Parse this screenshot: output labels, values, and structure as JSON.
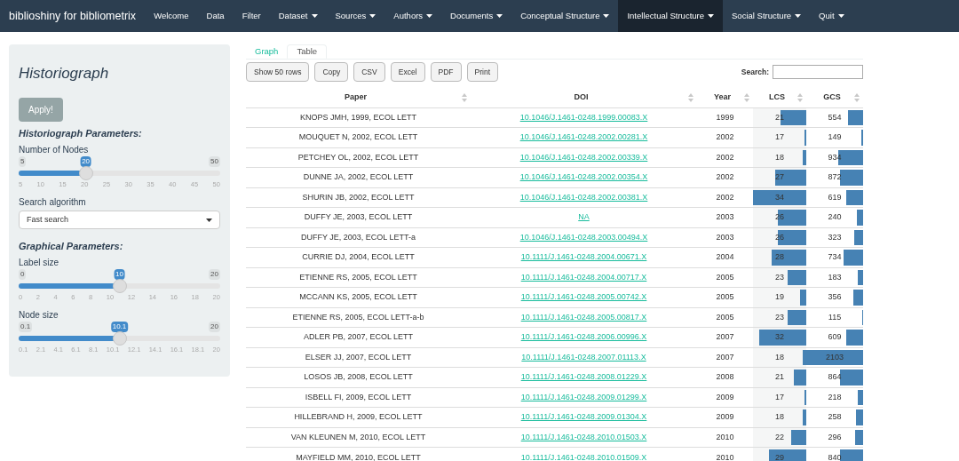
{
  "navbar": {
    "brand": "biblioshiny for bibliometrix",
    "items": [
      {
        "label": "Welcome",
        "dropdown": false,
        "selected": false
      },
      {
        "label": "Data",
        "dropdown": false,
        "selected": false
      },
      {
        "label": "Filter",
        "dropdown": false,
        "selected": false
      },
      {
        "label": "Dataset",
        "dropdown": true,
        "selected": false
      },
      {
        "label": "Sources",
        "dropdown": true,
        "selected": false
      },
      {
        "label": "Authors",
        "dropdown": true,
        "selected": false
      },
      {
        "label": "Documents",
        "dropdown": true,
        "selected": false
      },
      {
        "label": "Conceptual Structure",
        "dropdown": true,
        "selected": false
      },
      {
        "label": "Intellectual Structure",
        "dropdown": true,
        "selected": true
      },
      {
        "label": "Social Structure",
        "dropdown": true,
        "selected": false
      },
      {
        "label": "Quit",
        "dropdown": true,
        "selected": false
      }
    ]
  },
  "sidebar": {
    "title": "Historiograph",
    "apply_button": "Apply!",
    "sections": [
      {
        "heading": "Historiograph Parameters:",
        "controls": [
          {
            "kind": "slider",
            "label": "Number of Nodes",
            "min": "5",
            "max": "50",
            "value": "20",
            "level": 0.333,
            "ticks": [
              "5",
              "10",
              "15",
              "20",
              "25",
              "30",
              "35",
              "40",
              "45",
              "50"
            ]
          },
          {
            "kind": "select",
            "label": "Search algorithm",
            "value": "Fast search"
          }
        ]
      },
      {
        "heading": "Graphical Parameters:",
        "controls": [
          {
            "kind": "slider",
            "label": "Label size",
            "min": "0",
            "max": "20",
            "value": "10",
            "level": 0.5,
            "ticks": [
              "0",
              "2",
              "4",
              "6",
              "8",
              "10",
              "12",
              "14",
              "16",
              "18",
              "20"
            ]
          },
          {
            "kind": "slider",
            "label": "Node size",
            "min": "0.1",
            "max": "20",
            "value": "10.1",
            "level": 0.5,
            "ticks": [
              "0.1",
              "2.1",
              "4.1",
              "6.1",
              "8.1",
              "10.1",
              "12.1",
              "14.1",
              "16.1",
              "18.1",
              "20"
            ]
          }
        ]
      }
    ]
  },
  "tabs": [
    {
      "label": "Graph",
      "selected": false
    },
    {
      "label": "Table",
      "selected": true
    }
  ],
  "toolbar": {
    "buttons": [
      "Show 50 rows",
      "Copy",
      "CSV",
      "Excel",
      "PDF",
      "Print"
    ],
    "search_label": "Search:"
  },
  "table": {
    "columns": [
      "Paper",
      "DOI",
      "Year",
      "LCS",
      "GCS"
    ],
    "rows": [
      {
        "paper": "KNOPS JMH, 1999, ECOL LETT",
        "doi": "10.1046/J.1461-0248.1999.00083.X",
        "year": "1999",
        "lcs": {
          "text": "21",
          "level": 0.49
        },
        "gcs": {
          "text": "554",
          "level": 0.26
        }
      },
      {
        "paper": "MOUQUET N, 2002, ECOL LETT",
        "doi": "10.1046/J.1461-0248.2002.00281.X",
        "year": "2002",
        "lcs": {
          "text": "17",
          "level": 0.03
        },
        "gcs": {
          "text": "149",
          "level": 0.03
        }
      },
      {
        "paper": "PETCHEY OL, 2002, ECOL LETT",
        "doi": "10.1046/J.1461-0248.2002.00339.X",
        "year": "2002",
        "lcs": {
          "text": "18",
          "level": 0.06
        },
        "gcs": {
          "text": "934",
          "level": 0.44
        }
      },
      {
        "paper": "DUNNE JA, 2002, ECOL LETT",
        "doi": "10.1046/J.1461-0248.2002.00354.X",
        "year": "2002",
        "lcs": {
          "text": "27",
          "level": 0.58
        },
        "gcs": {
          "text": "872",
          "level": 0.41
        }
      },
      {
        "paper": "SHURIN JB, 2002, ECOL LETT",
        "doi": "10.1046/J.1461-0248.2002.00381.X",
        "year": "2002",
        "lcs": {
          "text": "34",
          "level": 1
        },
        "gcs": {
          "text": "619",
          "level": 0.29
        }
      },
      {
        "paper": "DUFFY JE, 2003, ECOL LETT",
        "doi": "NA",
        "year": "2003",
        "lcs": {
          "text": "26",
          "level": 0.53
        },
        "gcs": {
          "text": "240",
          "level": 0.11
        }
      },
      {
        "paper": "DUFFY JE, 2003, ECOL LETT-a",
        "doi": "10.1046/J.1461-0248.2003.00494.X",
        "year": "2003",
        "lcs": {
          "text": "26",
          "level": 0.53
        },
        "gcs": {
          "text": "323",
          "level": 0.15
        }
      },
      {
        "paper": "CURRIE DJ, 2004, ECOL LETT",
        "doi": "10.1111/J.1461-0248.2004.00671.X",
        "year": "2004",
        "lcs": {
          "text": "28",
          "level": 0.65
        },
        "gcs": {
          "text": "734",
          "level": 0.35
        }
      },
      {
        "paper": "ETIENNE RS, 2005, ECOL LETT",
        "doi": "10.1111/J.1461-0248.2004.00717.X",
        "year": "2005",
        "lcs": {
          "text": "23",
          "level": 0.35
        },
        "gcs": {
          "text": "183",
          "level": 0.09
        }
      },
      {
        "paper": "MCCANN KS, 2005, ECOL LETT",
        "doi": "10.1111/J.1461-0248.2005.00742.X",
        "year": "2005",
        "lcs": {
          "text": "19",
          "level": 0.12
        },
        "gcs": {
          "text": "356",
          "level": 0.17
        }
      },
      {
        "paper": "ETIENNE RS, 2005, ECOL LETT-a-b",
        "doi": "10.1111/J.1461-0248.2005.00817.X",
        "year": "2005",
        "lcs": {
          "text": "23",
          "level": 0.35
        },
        "gcs": {
          "text": "115",
          "level": 0.01
        }
      },
      {
        "paper": "ADLER PB, 2007, ECOL LETT",
        "doi": "10.1111/J.1461-0248.2006.00996.X",
        "year": "2007",
        "lcs": {
          "text": "32",
          "level": 0.88
        },
        "gcs": {
          "text": "609",
          "level": 0.29
        }
      },
      {
        "paper": "ELSER JJ, 2007, ECOL LETT",
        "doi": "10.1111/J.1461-0248.2007.01113.X",
        "year": "2007",
        "lcs": {
          "text": "18",
          "level": 0.06
        },
        "gcs": {
          "text": "2103",
          "level": 1
        }
      },
      {
        "paper": "LOSOS JB, 2008, ECOL LETT",
        "doi": "10.1111/J.1461-0248.2008.01229.X",
        "year": "2008",
        "lcs": {
          "text": "21",
          "level": 0.24
        },
        "gcs": {
          "text": "864",
          "level": 0.41
        }
      },
      {
        "paper": "ISBELL FI, 2009, ECOL LETT",
        "doi": "10.1111/J.1461-0248.2009.01299.X",
        "year": "2009",
        "lcs": {
          "text": "17",
          "level": 0.03
        },
        "gcs": {
          "text": "218",
          "level": 0.1
        }
      },
      {
        "paper": "HILLEBRAND H, 2009, ECOL LETT",
        "doi": "10.1111/J.1461-0248.2009.01304.X",
        "year": "2009",
        "lcs": {
          "text": "18",
          "level": 0.06
        },
        "gcs": {
          "text": "258",
          "level": 0.12
        }
      },
      {
        "paper": "VAN KLEUNEN M, 2010, ECOL LETT",
        "doi": "10.1111/J.1461-0248.2010.01503.X",
        "year": "2010",
        "lcs": {
          "text": "22",
          "level": 0.29
        },
        "gcs": {
          "text": "296",
          "level": 0.14
        }
      },
      {
        "paper": "MAYFIELD MM, 2010, ECOL LETT",
        "doi": "10.1111/J.1461-0248.2010.01509.X",
        "year": "2010",
        "lcs": {
          "text": "29",
          "level": 0.7
        },
        "gcs": {
          "text": "840",
          "level": 0.4
        }
      }
    ]
  }
}
